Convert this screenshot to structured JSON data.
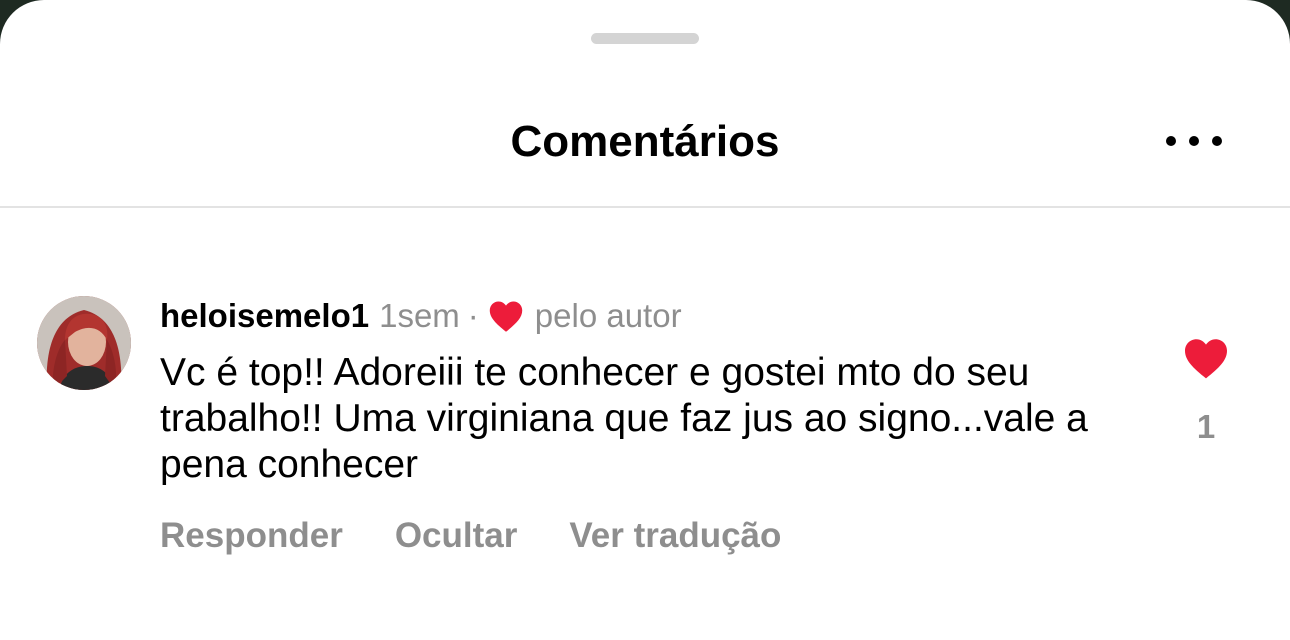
{
  "sheet": {
    "title": "Comentários"
  },
  "comment": {
    "username": "heloisemelo1",
    "time": "1sem",
    "separator": "·",
    "liked_by_author_label": "pelo autor",
    "text": "Vc é top!! Adoreiii te conhecer e  gostei mto do seu trabalho!! Uma virginiana que faz jus ao signo...vale a pena conhecer",
    "actions": {
      "reply": "Responder",
      "hide": "Ocultar",
      "translate": "Ver tradução"
    },
    "likes": "1"
  },
  "icons": {
    "more": "more-horizontal-icon",
    "author_heart": "heart-filled-icon",
    "like": "heart-filled-icon"
  },
  "colors": {
    "heart": "#ed1c3a",
    "secondary_text": "#8e8e8e"
  }
}
